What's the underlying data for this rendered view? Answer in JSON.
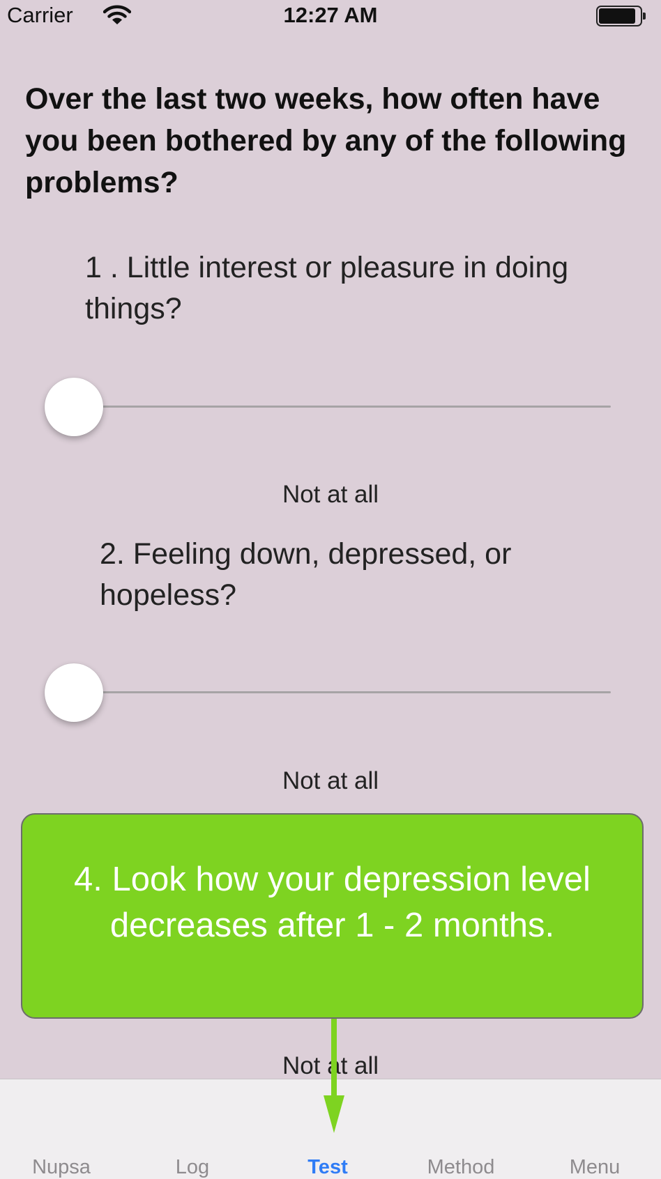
{
  "status_bar": {
    "carrier": "Carrier",
    "time": "12:27 AM",
    "wifi_icon": "wifi-icon",
    "battery_icon": "battery-icon",
    "battery_level": 0.9
  },
  "prompt": "Over the last two weeks, how often have you been bothered by any of the following problems?",
  "questions": [
    {
      "text": "1 . Little interest or pleasure in doing things?",
      "answer": "Not at all",
      "slider_value": 0
    },
    {
      "text": "2. Feeling down, depressed, or hopeless?",
      "answer": "Not at all",
      "slider_value": 0
    },
    {
      "answer": "Not at all"
    }
  ],
  "tip": {
    "text": "4. Look how your depression level decreases after 1 - 2 months.",
    "color": "#7ed321",
    "arrow_icon": "arrow-down-icon"
  },
  "tab_bar": {
    "tabs": [
      {
        "label": "Nupsa"
      },
      {
        "label": "Log"
      },
      {
        "label": "Test"
      },
      {
        "label": "Method"
      },
      {
        "label": "Menu"
      }
    ],
    "active_tab": "Test",
    "active_color": "#2f7cf6"
  }
}
